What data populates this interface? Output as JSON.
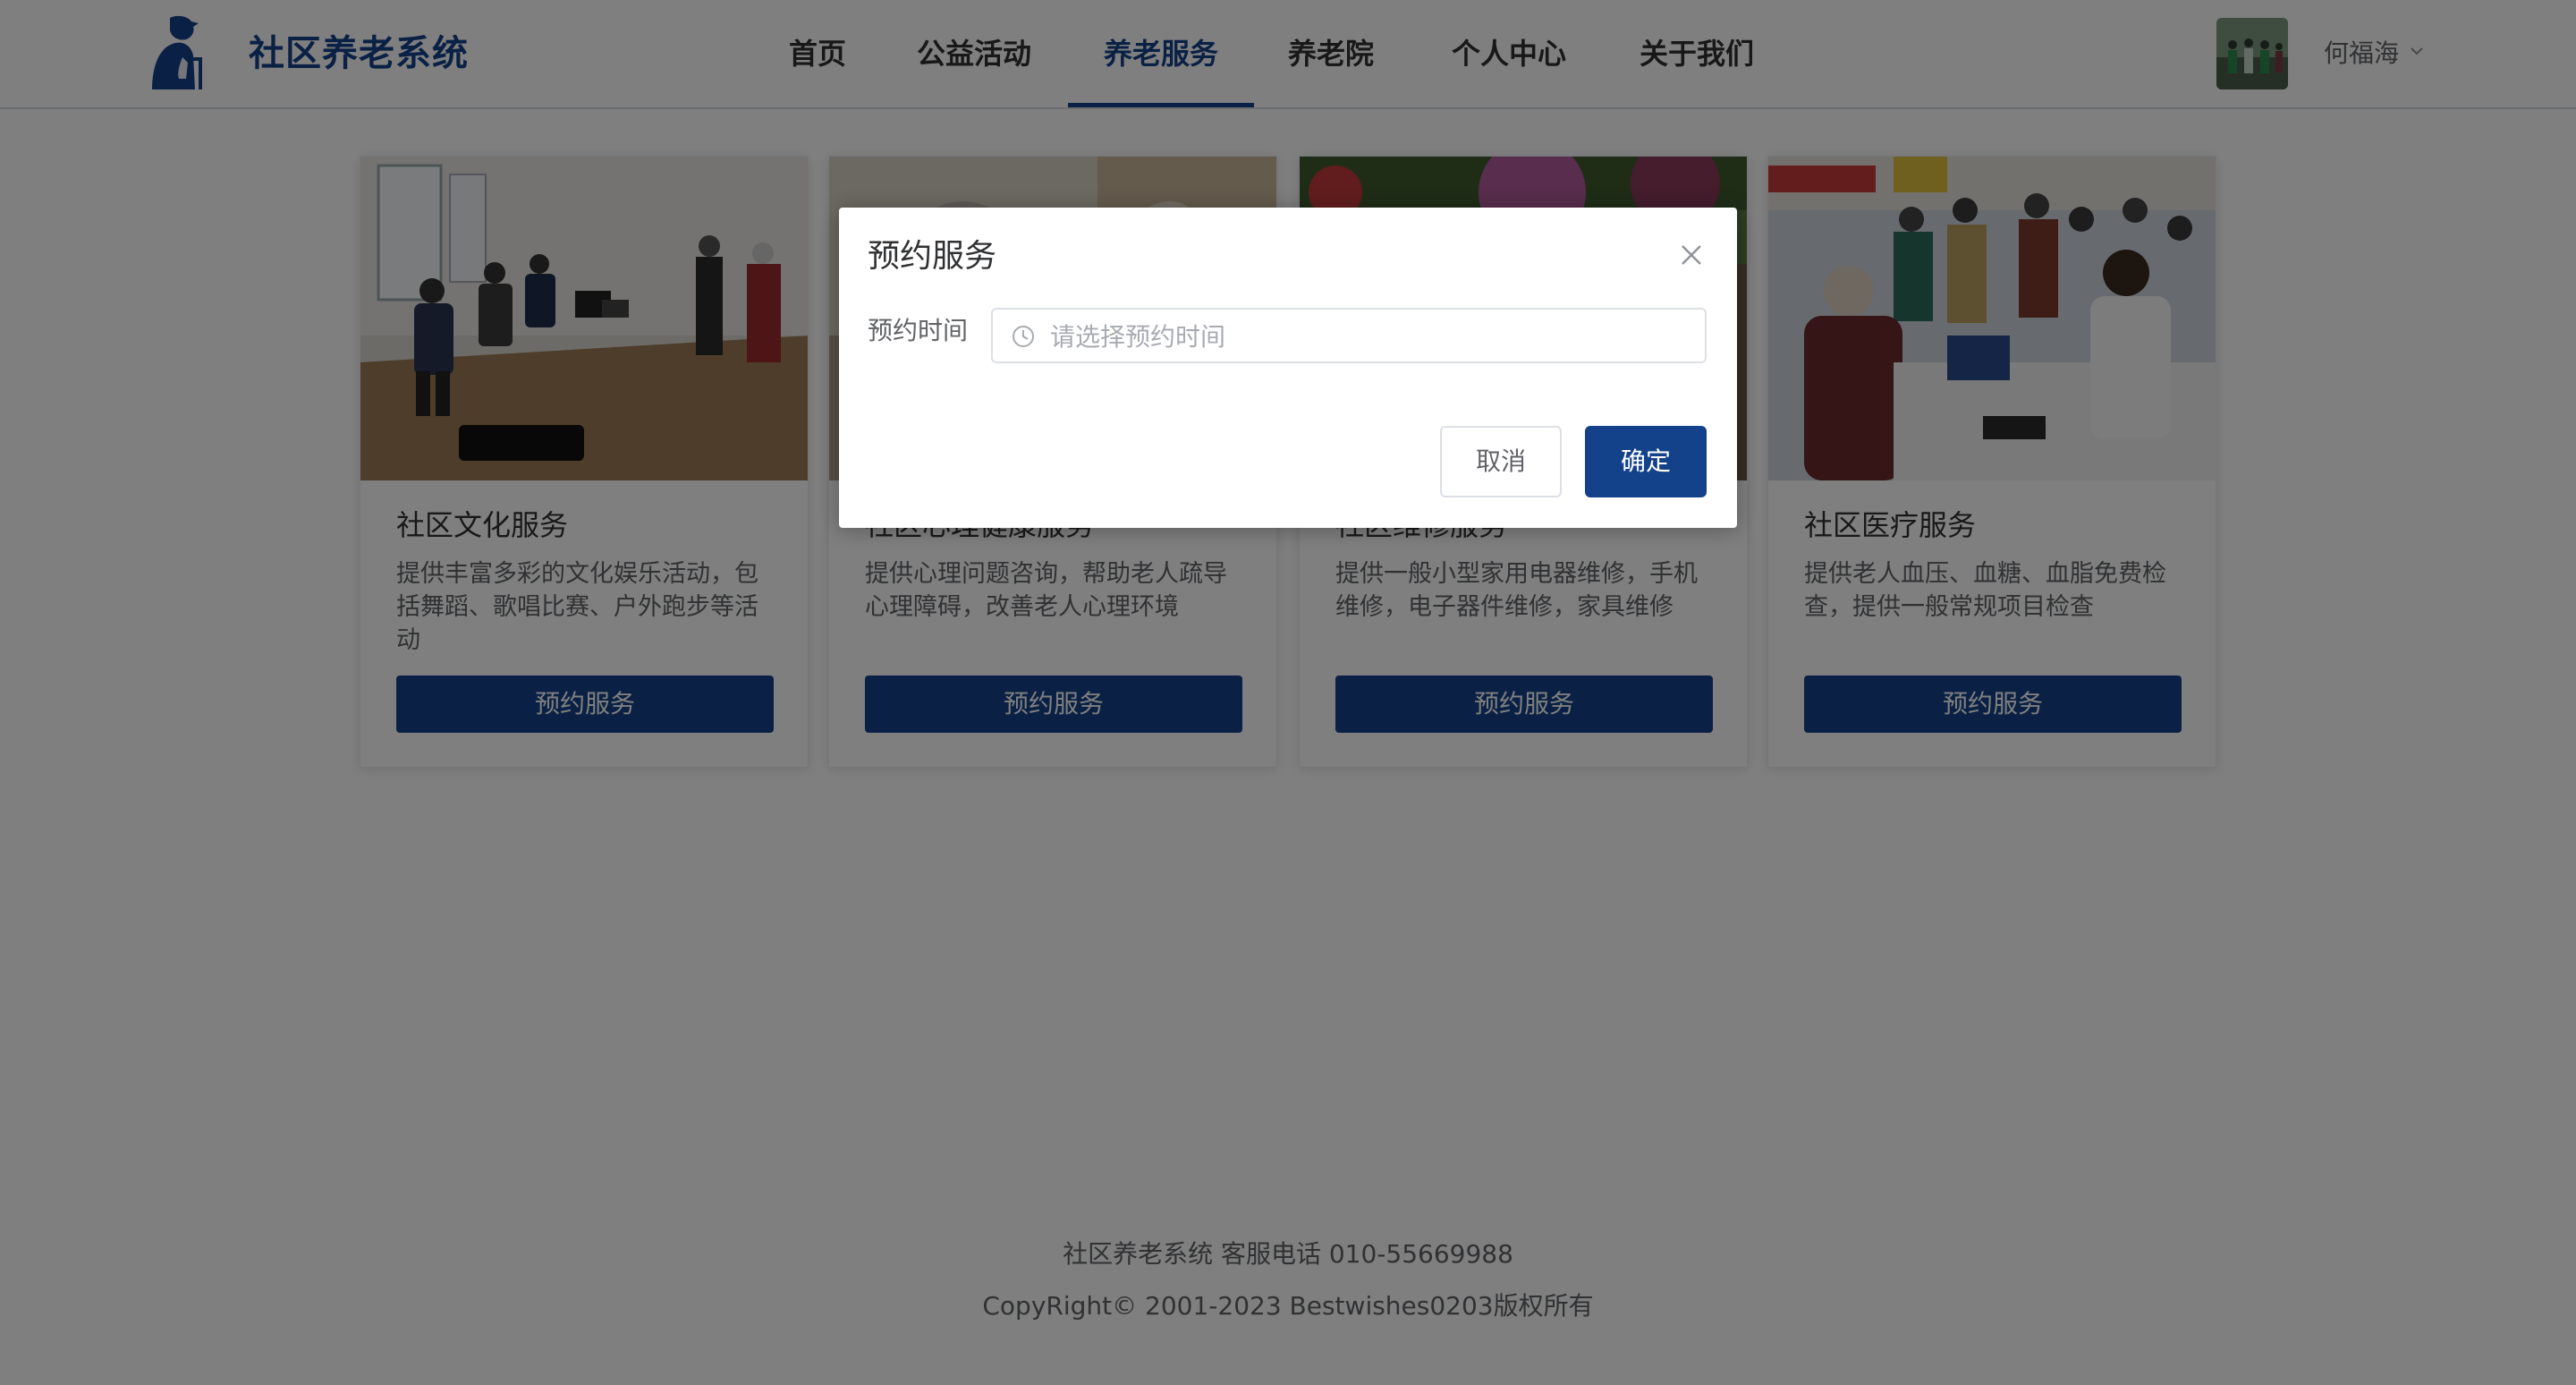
{
  "brand": {
    "name": "社区养老系统",
    "logo_icon": "elderly-person-icon",
    "color": "#14428a"
  },
  "nav": {
    "items": [
      {
        "label": "首页"
      },
      {
        "label": "公益活动"
      },
      {
        "label": "养老服务",
        "active": true
      },
      {
        "label": "养老院"
      },
      {
        "label": "个人中心"
      },
      {
        "label": "关于我们"
      }
    ]
  },
  "user": {
    "name": "何福海",
    "caret_icon": "chevron-down-icon"
  },
  "cards": [
    {
      "title": "社区文化服务",
      "description": "提供丰富多彩的文化娱乐活动，包括舞蹈、歌唱比赛、户外跑步等活动",
      "button": "预约服务"
    },
    {
      "title": "社区心理健康服务",
      "description": "提供心理问题咨询，帮助老人疏导心理障碍，改善老人心理环境",
      "button": "预约服务"
    },
    {
      "title": "社区维修服务",
      "description": "提供一般小型家用电器维修，手机维修，电子器件维修，家具维修",
      "button": "预约服务"
    },
    {
      "title": "社区医疗服务",
      "description": "提供老人血压、血糖、血脂免费检查，提供一般常规项目检查",
      "button": "预约服务"
    }
  ],
  "footer": {
    "line1": "社区养老系统 客服电话 010-55669988",
    "line2": "CopyRight© 2001-2023 Bestwishes0203版权所有"
  },
  "dialog": {
    "title": "预约服务",
    "field_label": "预约时间",
    "field_value": "",
    "field_placeholder": "请选择预约时间",
    "cancel": "取消",
    "confirm": "确定",
    "close_icon": "close-icon",
    "clock_icon": "clock-icon"
  },
  "colors": {
    "primary": "#14428a",
    "overlay": "rgba(0,0,0,0.5)"
  }
}
